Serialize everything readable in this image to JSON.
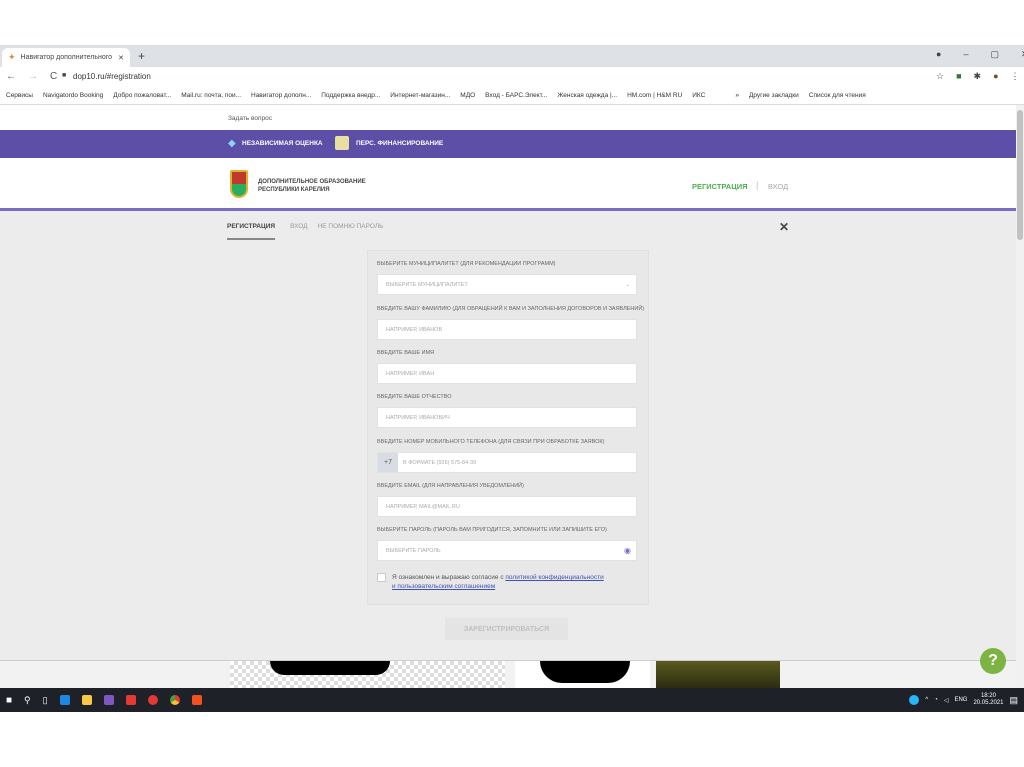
{
  "browser": {
    "tab_title": "Навигатор дополнительного о",
    "url": "dop10.ru/#registration",
    "bookmarks": [
      "Сервисы",
      "Navigatordo Booking",
      "Добро пожаловат...",
      "Mail.ru: почта, пои...",
      "Навигатор дополн...",
      "Поддержка внедр...",
      "Интернет-магазин...",
      "МДО",
      "Вход - БАРС.Элект...",
      "Женская одежда |...",
      "HM.com | H&M RU",
      "ИКС",
      "»",
      "Другие закладки",
      "Список для чтения"
    ]
  },
  "site": {
    "ask": "Задать вопрос",
    "nav": [
      "НЕЗАВИСИМАЯ ОЦЕНКА",
      "ПЕРС. ФИНАНСИРОВАНИЕ"
    ],
    "logo_line1": "ДОПОЛНИТЕЛЬНОЕ ОБРАЗОВАНИЕ",
    "logo_line2": "РЕСПУБЛИКИ КАРЕЛИЯ",
    "register": "РЕГИСТРАЦИЯ",
    "login": "ВХОД",
    "sep": "|"
  },
  "tabs": [
    "РЕГИСТРАЦИЯ",
    "ВХОД",
    "НЕ ПОМНЮ ПАРОЛЬ"
  ],
  "form": {
    "municipality_label": "Выберите муниципалитет (для рекомендации программ)",
    "municipality_placeholder": "Выберите муниципалитет",
    "surname_label": "Введите вашу фамилию (для обращений к вам и заполнения договоров и заявлений)",
    "surname_placeholder": "Например, Иванов",
    "name_label": "Введите ваше имя",
    "name_placeholder": "Например, Иван",
    "patronymic_label": "Введите ваше отчество",
    "patronymic_placeholder": "Например, Иванович",
    "phone_label": "Введите номер мобильного телефона (для связи при обработке заявок)",
    "phone_prefix": "+7",
    "phone_placeholder": "В формате (926) 575-84-39",
    "email_label": "Введите email (для направления уведомлений)",
    "email_placeholder": "Например, mail@mail.ru",
    "password_label": "Выберите пароль (пароль вам пригодится, запомните или запишите его)",
    "password_placeholder": "Выберите пароль",
    "consent_text": "Я ознакомлен и выражаю согласие с ",
    "consent_link1": "политикой конфиденциальности",
    "consent_link2": "и пользовательским соглашением",
    "submit": "ЗАРЕГИСТРИРОВАТЬСЯ"
  },
  "taskbar": {
    "lang": "ENG",
    "time": "18:20",
    "date": "20.05.2021"
  },
  "colors": {
    "purple": "#5d4fa8",
    "green": "#4caf50"
  }
}
